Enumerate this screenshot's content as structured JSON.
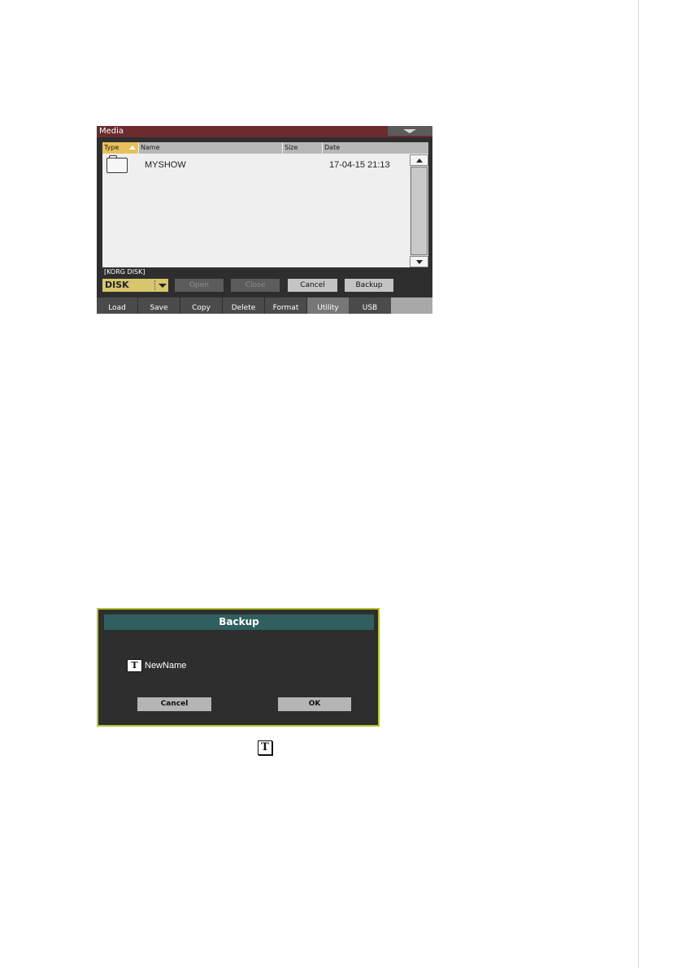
{
  "media": {
    "title": "Media",
    "columns": {
      "type": "Type",
      "name": "Name",
      "size": "Size",
      "date": "Date"
    },
    "files": [
      {
        "icon": "folder-icon",
        "name": "MYSHOW",
        "size": "",
        "date": "17-04-15 21:13"
      }
    ],
    "path": "[KORG DISK]",
    "drive": "DISK",
    "buttons": {
      "open": "Open",
      "close": "Close",
      "cancel": "Cancel",
      "backup": "Backup"
    },
    "tabs": [
      {
        "label": "Load"
      },
      {
        "label": "Save"
      },
      {
        "label": "Copy"
      },
      {
        "label": "Delete"
      },
      {
        "label": "Format"
      },
      {
        "label": "Utility",
        "active": true
      },
      {
        "label": "USB"
      }
    ]
  },
  "dialog": {
    "title": "Backup",
    "text_icon_glyph": "T",
    "name_value": "NewName",
    "cancel": "Cancel",
    "ok": "OK"
  },
  "inline_icon": {
    "glyph": "T"
  },
  "colors": {
    "title_bar": "#6b2c30",
    "type_header_accent": "#e9c15a",
    "drive_selector": "#d8c66c",
    "dialog_border": "#b4c42e",
    "dialog_title": "#2f5f5f"
  }
}
